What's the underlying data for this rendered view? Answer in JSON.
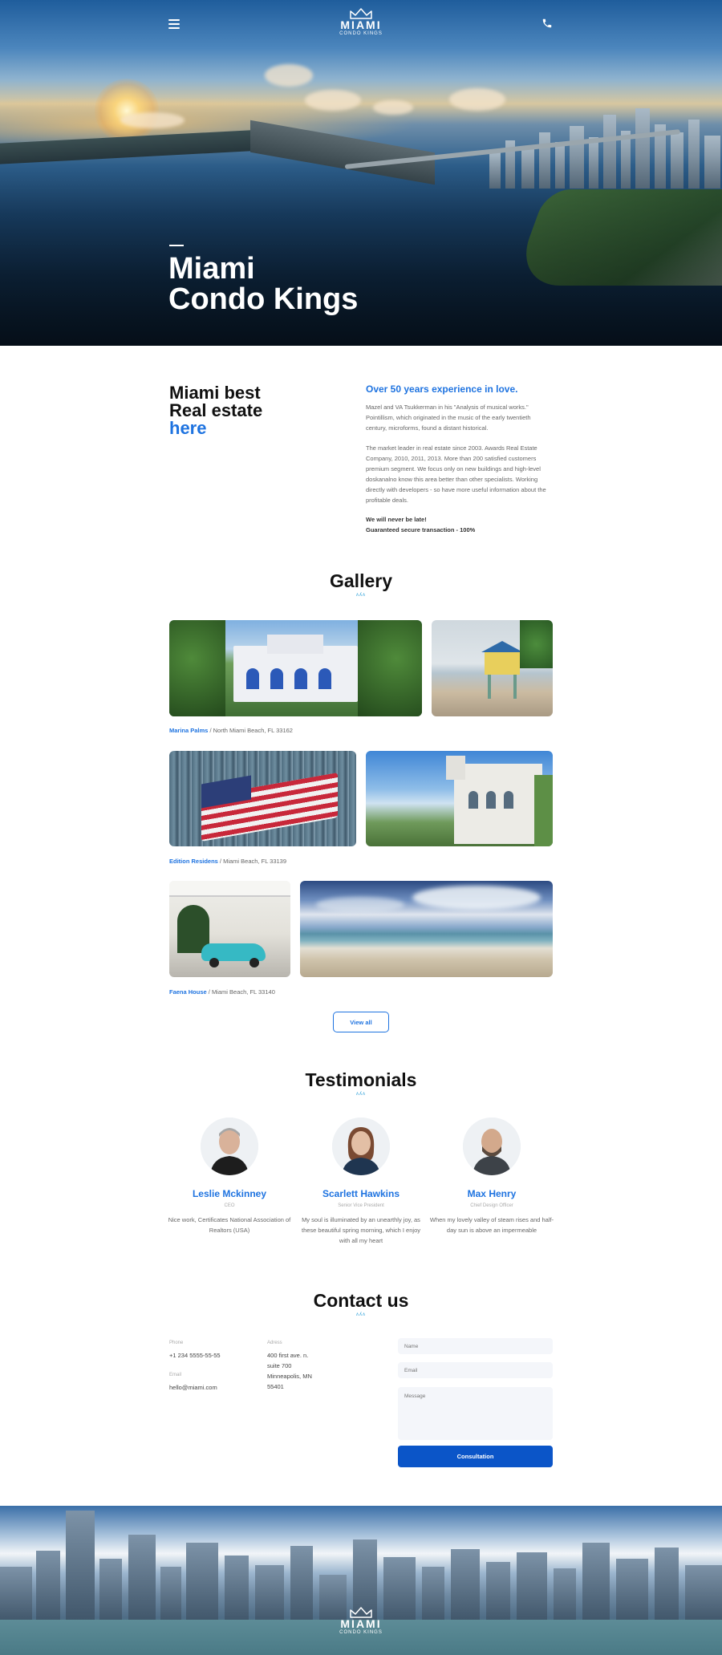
{
  "header": {
    "logo_text": "MIAMI",
    "logo_subtext": "CONDO KINGS",
    "menu_icon": "hamburger-menu-icon",
    "phone_icon": "phone-icon"
  },
  "hero": {
    "title_line1": "Miami",
    "title_line2": "Condo Kings"
  },
  "about": {
    "heading_line1": "Miami best",
    "heading_line2": "Real estate",
    "heading_accent": "here",
    "subheading": "Over 50 years experience in love.",
    "paragraph1": "Mazel and VA Tsukkerman in his \"Analysis of musical works.\" Pointillism, which originated in the music of the early twentieth century, microforms, found a distant historical.",
    "paragraph2": "The market leader in real estate since 2003. Awards Real Estate Company, 2010, 2011, 2013. More than 200 satisfied customers premium segment. We focus only on new buildings and high-level doskanalno know this area better than other specialists. Working directly with developers - so have more useful information about the profitable deals.",
    "bold_line1": "We will never be late!",
    "bold_line2": "Guaranteed secure transaction - 100%"
  },
  "gallery": {
    "title": "Gallery",
    "mark": "ʌʎʌ",
    "captions": [
      {
        "place": "Marina Palms",
        "address": " / North Miami Beach, FL 33162"
      },
      {
        "place": "Edition Residens",
        "address": " / Miami Beach, FL 33139"
      },
      {
        "place": "Faena House",
        "address": " / Miami Beach, FL 33140"
      }
    ],
    "view_all_label": "View all"
  },
  "testimonials": {
    "title": "Testimonials",
    "mark": "ʌʎʌ",
    "items": [
      {
        "name": "Leslie Mckinney",
        "role": "CEO",
        "text": "Nice work, Certificates National Association of Realtors (USA)"
      },
      {
        "name": "Scarlett Hawkins",
        "role": "Senior Vice President",
        "text": "My soul is illuminated by an unearthly joy, as these beautiful spring morning, which I enjoy with all my heart"
      },
      {
        "name": "Max Henry",
        "role": "Chief Design Officer",
        "text": "When my lovely valley of steam rises and half-day sun is above an impermeable"
      }
    ]
  },
  "contact": {
    "title": "Contact us",
    "mark": "ʌʎʌ",
    "phone_label": "Phone",
    "phone_value": "+1 234 5555-55-55",
    "email_label": "Email",
    "email_value": "hello@miami.com",
    "address_label": "Adress",
    "address_line1": "400 first ave. n.",
    "address_line2": "suite 700",
    "address_line3": "Minneapolis, MN",
    "address_line4": "55401",
    "form": {
      "name_placeholder": "Name",
      "email_placeholder": "Email",
      "message_placeholder": "Message",
      "submit_label": "Consultation"
    }
  },
  "colors": {
    "accent": "#1e73e0",
    "button": "#0b55c8",
    "mark": "#2a9fd8"
  }
}
